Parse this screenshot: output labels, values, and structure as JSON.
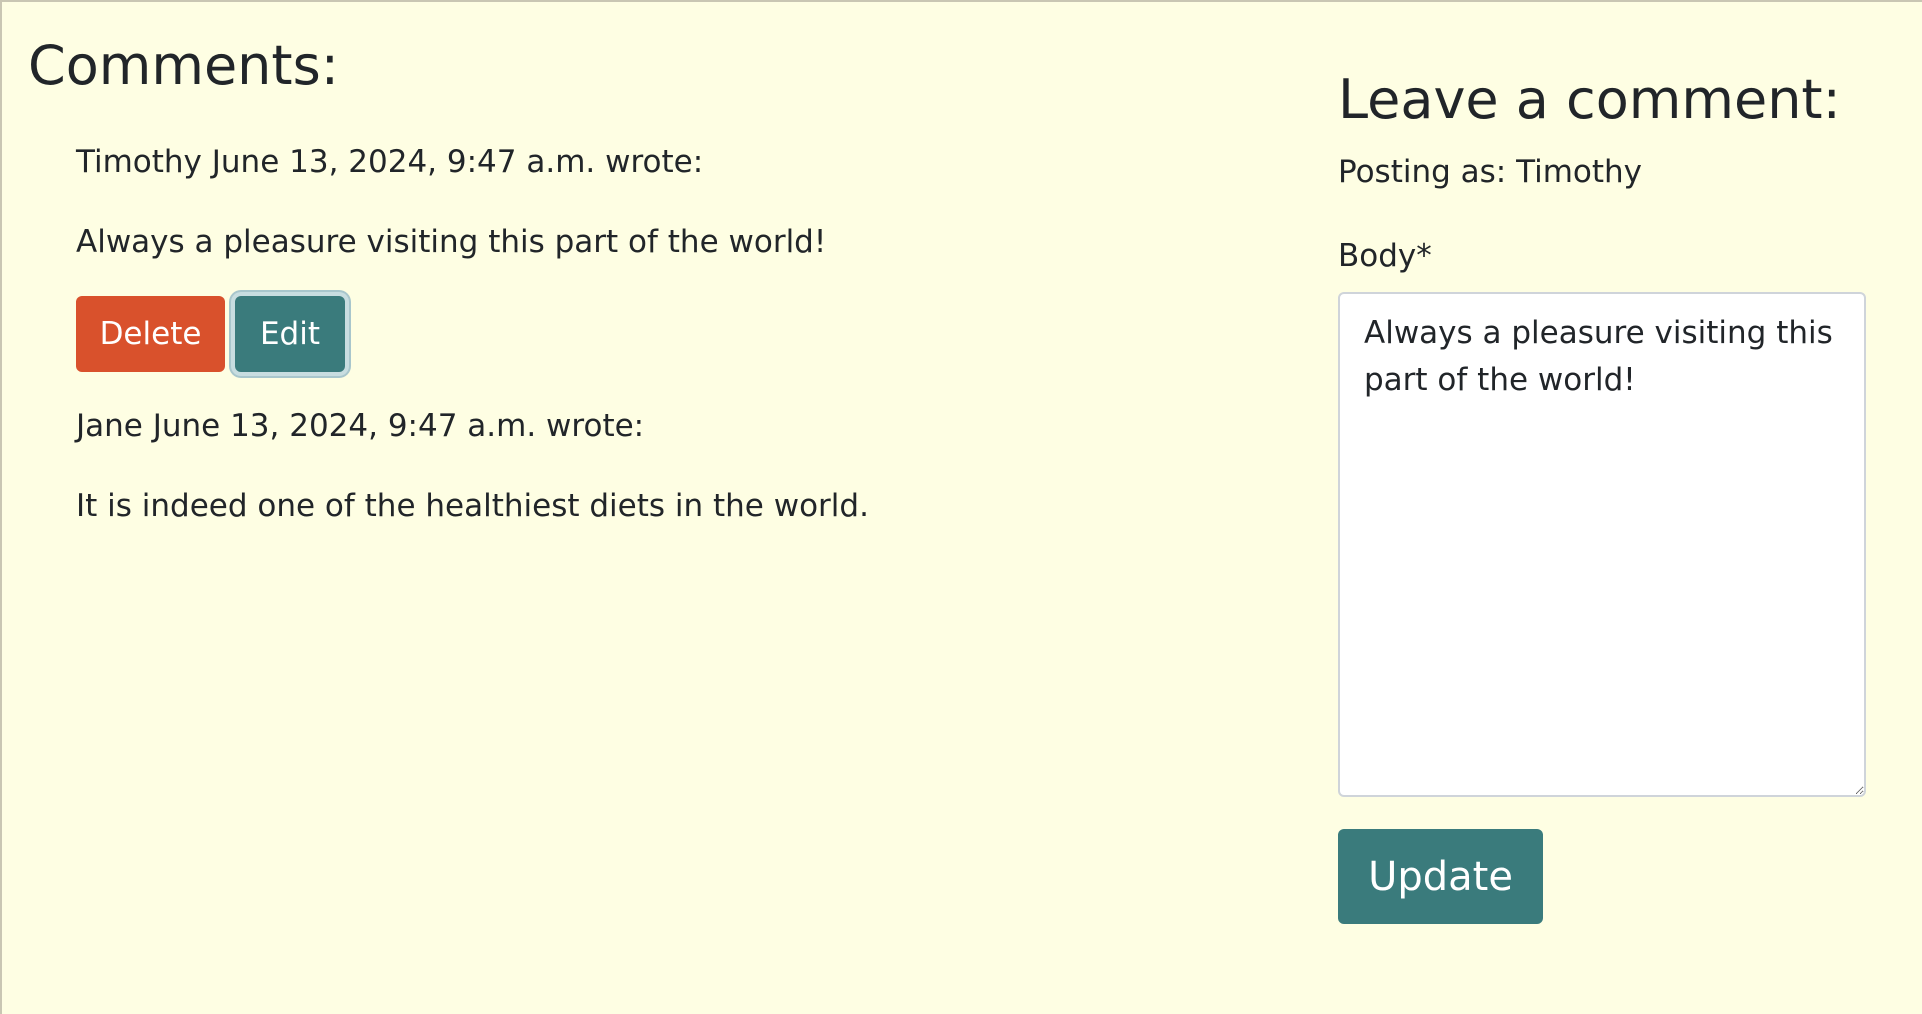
{
  "comments_section": {
    "heading": "Comments:",
    "comments": [
      {
        "meta": "Timothy June 13, 2024, 9:47 a.m. wrote:",
        "body": "Always a pleasure visiting this part of the world!",
        "delete_label": "Delete",
        "edit_label": "Edit"
      },
      {
        "meta": "Jane June 13, 2024, 9:47 a.m. wrote:",
        "body": "It is indeed one of the healthiest diets in the world."
      }
    ]
  },
  "comment_form": {
    "heading": "Leave a comment:",
    "posting_as": "Posting as: Timothy",
    "body_label": "Body*",
    "body_value": "Always a pleasure visiting this part of the world!",
    "submit_label": "Update"
  },
  "colors": {
    "page_background": "#fefee3",
    "delete_button": "#d9512c",
    "primary_button": "#3a7b7c",
    "text": "#212529"
  }
}
